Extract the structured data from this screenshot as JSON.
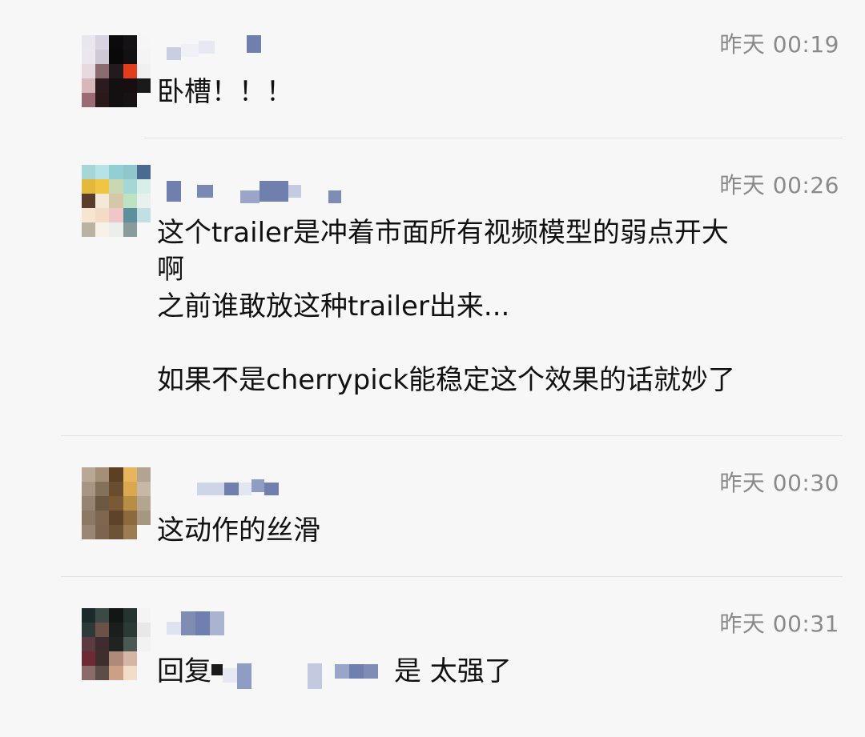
{
  "comments": [
    {
      "time": "昨天 00:19",
      "text": "卧槽！！！"
    },
    {
      "time": "昨天 00:26",
      "text": "这个trailer是冲着市面所有视频模型的弱点开大\n啊\n之前谁敢放这种trailer出来...\n\n如果不是cherrypick能稳定这个效果的话就妙了"
    },
    {
      "time": "昨天 00:30",
      "text": "这动作的丝滑"
    },
    {
      "time": "昨天 00:31",
      "reply_prefix": "回复",
      "text": "是 太强了"
    }
  ]
}
